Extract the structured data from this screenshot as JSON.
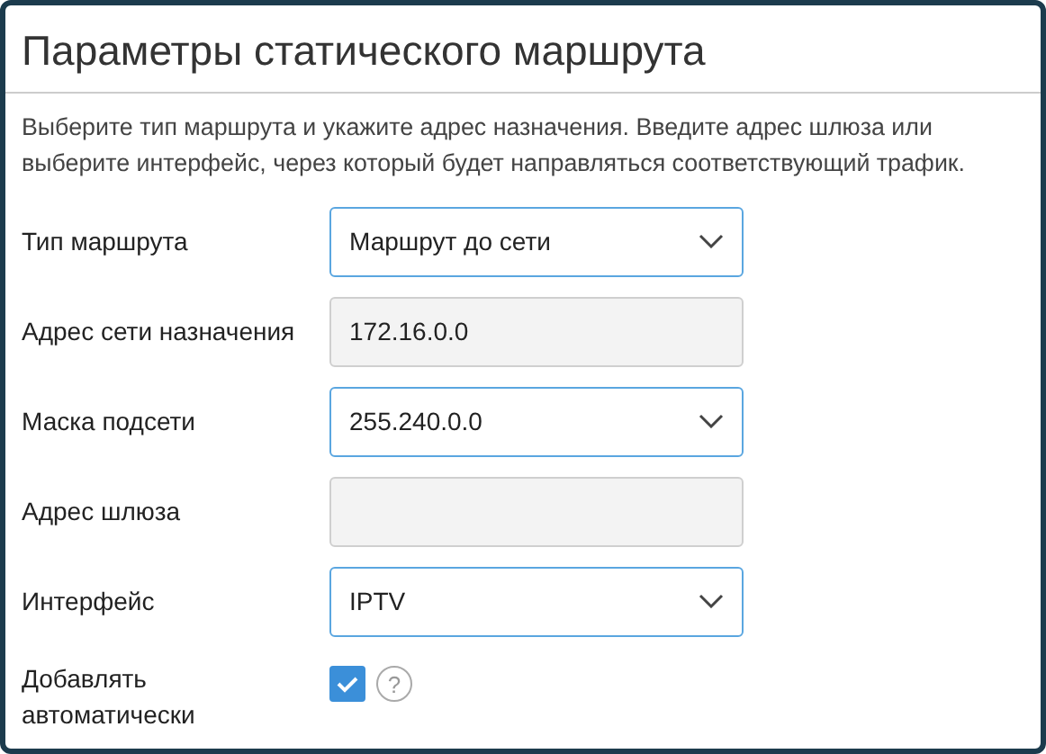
{
  "title": "Параметры статического маршрута",
  "description": "Выберите тип маршрута и укажите адрес назначения. Введите адрес шлюза или выберите интерфейс, через который будет направляться соответствующий трафик.",
  "fields": [
    {
      "label": "Тип маршрута",
      "kind": "select",
      "value": "Маршрут до сети",
      "disabled": false
    },
    {
      "label": "Адрес сети назначения",
      "kind": "text",
      "value": "172.16.0.0",
      "disabled": true
    },
    {
      "label": "Маска подсети",
      "kind": "select",
      "value": "255.240.0.0",
      "disabled": false
    },
    {
      "label": "Адрес шлюза",
      "kind": "text",
      "disabled": true
    },
    {
      "label": "Интерфейс",
      "kind": "select",
      "value": "IPTV",
      "disabled": false
    }
  ],
  "auto_add": {
    "label": "Добавлять автоматически",
    "checked": true,
    "help": "?"
  }
}
